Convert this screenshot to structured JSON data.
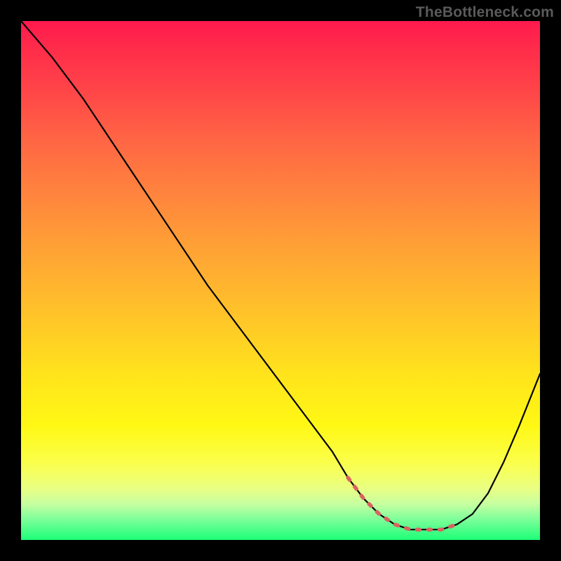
{
  "watermark": "TheBottleneck.com",
  "chart_data": {
    "type": "line",
    "title": "",
    "xlabel": "",
    "ylabel": "",
    "xlim": [
      0,
      100
    ],
    "ylim": [
      0,
      100
    ],
    "series": [
      {
        "name": "bottleneck-curve",
        "color": "#000000",
        "x": [
          0,
          6,
          12,
          18,
          24,
          30,
          36,
          42,
          48,
          54,
          60,
          63,
          66,
          69,
          72,
          75,
          78,
          81,
          84,
          87,
          90,
          93,
          96,
          100
        ],
        "values": [
          100,
          93,
          85,
          76,
          67,
          58,
          49,
          41,
          33,
          25,
          17,
          12,
          8,
          5,
          3,
          2,
          2,
          2,
          3,
          5,
          9,
          15,
          22,
          32
        ]
      },
      {
        "name": "optimal-segment",
        "color": "#d9635f",
        "style": "dashed",
        "x": [
          63,
          66,
          69,
          72,
          75,
          78,
          81,
          84
        ],
        "values": [
          12,
          8,
          5,
          3,
          2,
          2,
          2,
          3
        ]
      }
    ],
    "gradient_stops": [
      {
        "pos": 0,
        "color": "#ff1a4d"
      },
      {
        "pos": 50,
        "color": "#ffc22a"
      },
      {
        "pos": 80,
        "color": "#fff815"
      },
      {
        "pos": 100,
        "color": "#1dff77"
      }
    ]
  }
}
